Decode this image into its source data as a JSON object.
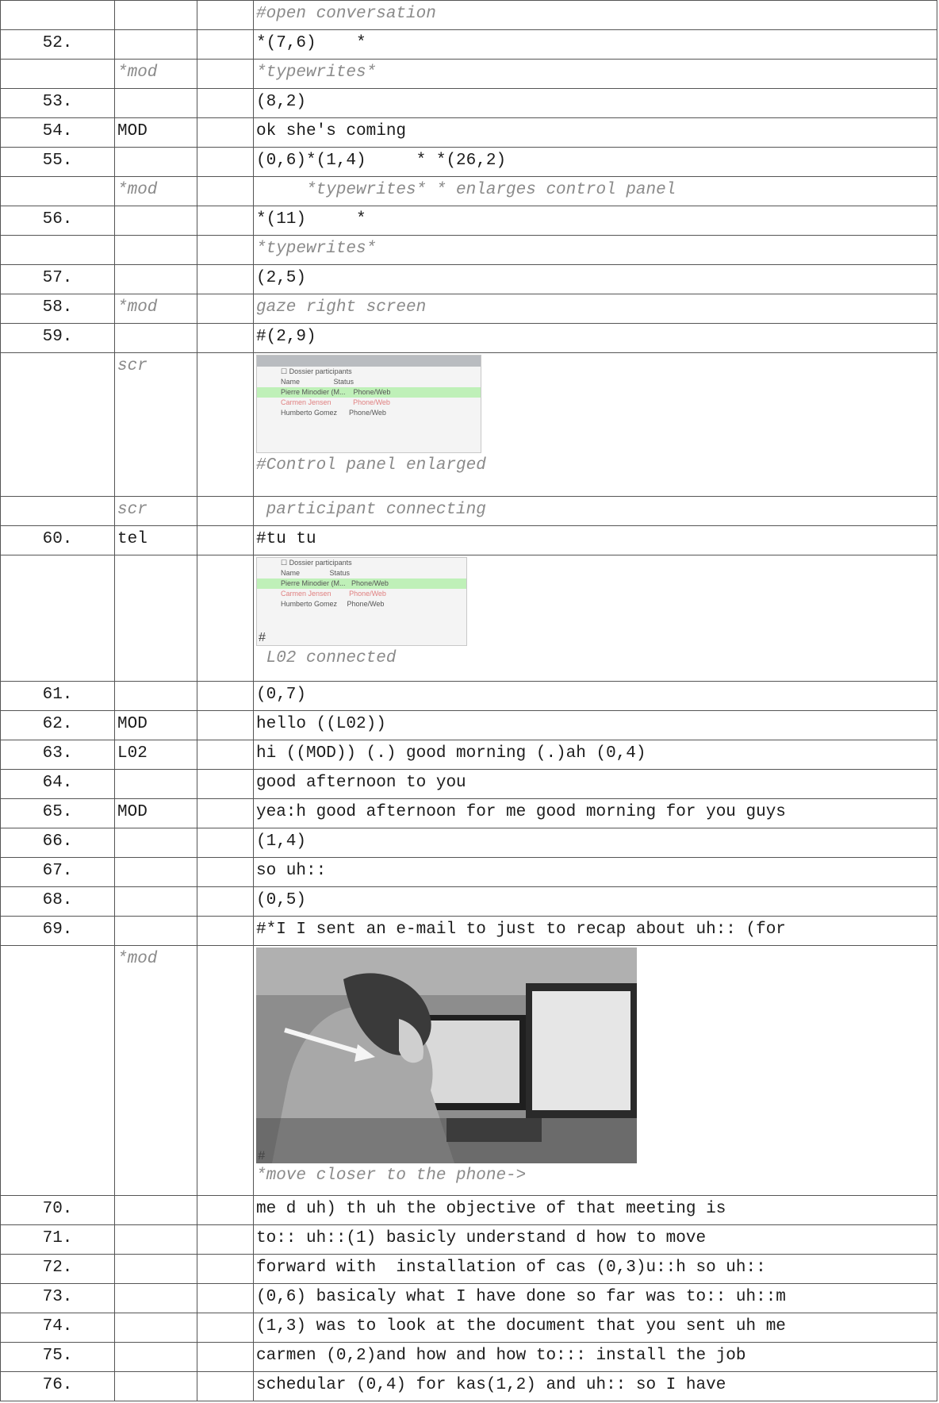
{
  "rows": [
    {
      "num": "",
      "speaker": "",
      "text": "#open conversation"
    },
    {
      "num": "52.",
      "speaker": "",
      "text": "*(7,6)    *"
    },
    {
      "num": "",
      "speaker": "*mod",
      "text": "*typewrites*"
    },
    {
      "num": "53.",
      "speaker": "",
      "text": "(8,2)"
    },
    {
      "num": "54.",
      "speaker": "MOD",
      "text": "ok she's coming"
    },
    {
      "num": "55.",
      "speaker": "",
      "text": "(0,6)*(1,4)     * *(26,2)"
    },
    {
      "num": "",
      "speaker": "*mod",
      "text": "     *typewrites* * enlarges control panel"
    },
    {
      "num": "56.",
      "speaker": "",
      "text": "*(11)     *"
    },
    {
      "num": "",
      "speaker": "",
      "text": "*typewrites*"
    },
    {
      "num": "57.",
      "speaker": "",
      "text": "(2,5)"
    },
    {
      "num": "58.",
      "speaker": "*mod",
      "text": "gaze right screen"
    },
    {
      "num": "59.",
      "speaker": "",
      "text": "#(2,9)"
    },
    {
      "num": "",
      "speaker": "scr",
      "text": "#Control panel enlarged"
    },
    {
      "num": "",
      "speaker": "scr",
      "text": " participant connecting"
    },
    {
      "num": "60.",
      "speaker": "tel",
      "text": "#tu tu"
    },
    {
      "num": "",
      "speaker": "",
      "text": " L02 connected"
    },
    {
      "num": "61.",
      "speaker": "",
      "text": "(0,7)"
    },
    {
      "num": "62.",
      "speaker": "MOD",
      "text": "hello ((L02))"
    },
    {
      "num": "63.",
      "speaker": "L02",
      "text": "hi ((MOD)) (.) good morning (.)ah (0,4)"
    },
    {
      "num": "64.",
      "speaker": "",
      "text": "good afternoon to you"
    },
    {
      "num": "65.",
      "speaker": "MOD",
      "text": "yea:h good afternoon for me good morning for you guys"
    },
    {
      "num": "66.",
      "speaker": "",
      "text": "(1,4)"
    },
    {
      "num": "67.",
      "speaker": "",
      "text": "so uh::"
    },
    {
      "num": "68.",
      "speaker": "",
      "text": "(0,5)"
    },
    {
      "num": "69.",
      "speaker": "",
      "text": "#*I I sent an e-mail to just to recap about uh:: (for"
    },
    {
      "num": "",
      "speaker": "*mod",
      "text": "*move closer to the phone->"
    },
    {
      "num": "70.",
      "speaker": "",
      "text": "me d uh) th uh the objective of that meeting is"
    },
    {
      "num": "71.",
      "speaker": "",
      "text": "to:: uh::(1) basicly understand d how to move"
    },
    {
      "num": "72.",
      "speaker": "",
      "text": "forward with  installation of cas (0,3)u::h so uh::"
    },
    {
      "num": "73.",
      "speaker": "",
      "text": "(0,6) basicaly what I have done so far was to:: uh::m"
    },
    {
      "num": "74.",
      "speaker": "",
      "text": "(1,3) was to look at the document that you sent uh me"
    },
    {
      "num": "75.",
      "speaker": "",
      "text": "carmen (0,2)and how and how to::: install the job"
    },
    {
      "num": "76.",
      "speaker": "",
      "text": "schedular (0,4) for kas(1,2) and uh:: so I have"
    }
  ],
  "panel1": {
    "checkbox_label": "Dossier participants",
    "col_name": "Name",
    "col_status": "Status",
    "entries": [
      {
        "name": "Pierre Minodier (M...",
        "status": "Phone/Web"
      },
      {
        "name": "Carmen Jensen",
        "status": "Phone/Web"
      },
      {
        "name": "Humberto Gomez",
        "status": "Phone/Web"
      }
    ]
  },
  "panel2": {
    "checkbox_label": "Dossier participants",
    "col_name": "Name",
    "col_status": "Status",
    "entries": [
      {
        "name": "Pierre Minodier (M...",
        "status": "Phone/Web"
      },
      {
        "name": "Carmen Jensen",
        "status": "Phone/Web"
      },
      {
        "name": "Humberto Gomez",
        "status": "Phone/Web"
      }
    ]
  },
  "photo_hash": "#",
  "panel2_hash": "#"
}
